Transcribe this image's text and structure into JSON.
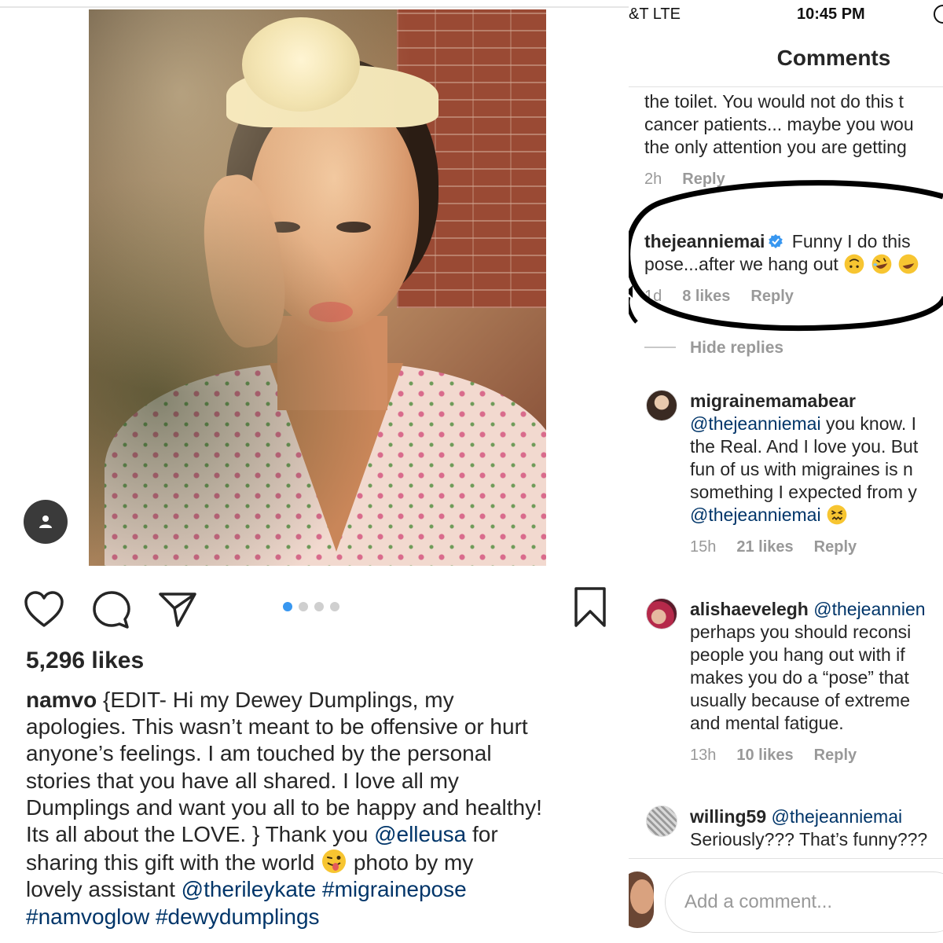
{
  "post": {
    "likes": "5,296 likes",
    "caption": {
      "username": "namvo",
      "line1_rest": " {EDIT- Hi my Dewey Dumplings, my",
      "line2": "apologies. This wasn’t meant to be offensive or hurt",
      "line3": "anyone’s feelings. I am touched by the personal",
      "line4": "stories that you have all shared. I love all my",
      "line5": "Dumplings and want you all to be happy and healthy!",
      "line6_start": "Its all about the LOVE. }  Thank you ",
      "mention_elleusa": "@elleusa",
      "line6_end": " for",
      "line7_start": "sharing this gift with the world ",
      "line7_end": "  photo by my",
      "line8_start": "lovely assistant ",
      "mention_therileykate": "@therileykate",
      "hashtag_migrainepose": "#migrainepose",
      "hashtag_namvoglow": "#namvoglow",
      "hashtag_dewydumplings": "#dewydumplings"
    },
    "carousel_dots": 4,
    "carousel_active": 1
  },
  "status_bar": {
    "carrier": "&T  LTE",
    "time": "10:45 PM"
  },
  "comments_header": {
    "title": "Comments"
  },
  "comments": {
    "c0": {
      "line1": "the toilet. You would not do this t",
      "line2": "cancer patients... maybe you wou",
      "line3": "the only attention you are getting",
      "time": "2h",
      "reply": "Reply"
    },
    "c1": {
      "username": "thejeanniemai",
      "text1": " Funny I do this",
      "text2": "pose...after we hang out ",
      "time": "1d",
      "likes": "8 likes",
      "reply": "Reply"
    },
    "hide_replies": "Hide replies",
    "c2": {
      "username": "migrainemamabear",
      "mention": "@thejeanniemai",
      "text1": " you know. I",
      "line2": "the Real. And I love you. But",
      "line3": "fun of us with migraines is n",
      "line4": "something I expected from y",
      "mention2": "@thejeanniemai",
      "time": "15h",
      "likes": "21 likes",
      "reply": "Reply"
    },
    "c3": {
      "username": "alishaevelegh",
      "mention": "@thejeannien",
      "line2": "perhaps you should reconsi",
      "line3": "people you hang out with if",
      "line4": "makes you do a “pose” that",
      "line5": "usually because of extreme",
      "line6": "and mental fatigue.",
      "time": "13h",
      "likes": "10 likes",
      "reply": "Reply"
    },
    "c4": {
      "username": "willing59",
      "mention": "@thejeanniemai",
      "line2": "Seriously??? That’s funny???"
    }
  },
  "add_comment": {
    "placeholder": "Add a comment..."
  },
  "colors": {
    "link": "#003569",
    "carousel_active": "#3897f0",
    "verified": "#3897f0",
    "meta": "#999999"
  }
}
